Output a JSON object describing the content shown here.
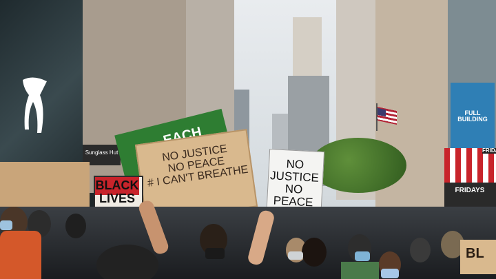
{
  "store_signs": {
    "puma_logo": "PUMA",
    "sunglass_hut": "Sunglass Hut",
    "fuller_building": "FULL BUILDING",
    "fridays_top": "FRIDAYS",
    "fridays_bottom": "FRIDAYS"
  },
  "protest_signs": {
    "black_lives_matter": "BLACK\nLIVES\nMATTER",
    "no_justice_board": "NO JUSTICE\nNO PEACE\n# I CAN'T BREATHE",
    "no_justice_white": "NO\nJUSTICE\nNO\nPEACE",
    "green_banner_partial": "EACH",
    "right_edge_partial": "BL"
  },
  "colors": {
    "sky": "#e9ecef",
    "cardboard": "#d9b98e",
    "blm_red": "#c8242b",
    "banner_green": "#2e7d32",
    "flag_red": "#b22234"
  }
}
